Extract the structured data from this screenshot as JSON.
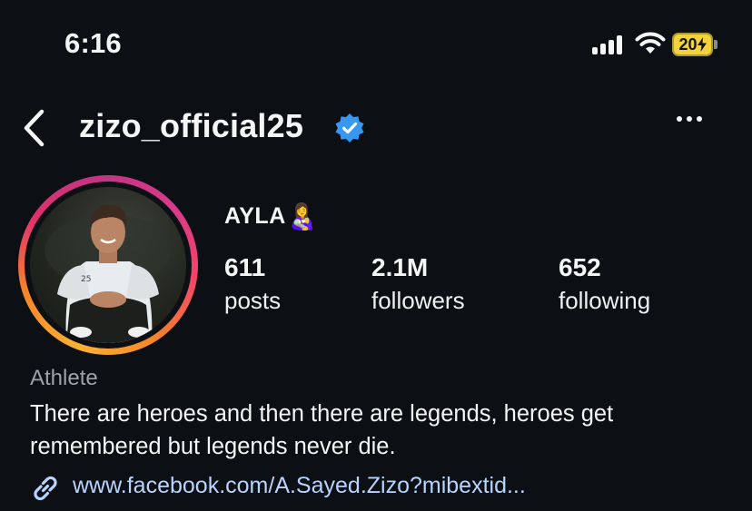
{
  "status_bar": {
    "time": "6:16",
    "battery": "20",
    "battery_color": "#f3d23a"
  },
  "header": {
    "username": "zizo_official25",
    "icons": [
      "chevron-left-icon",
      "verified-badge-icon",
      "more-horizontal-icon"
    ]
  },
  "profile": {
    "display_name": "AYLA",
    "display_emoji": "👩‍🍼",
    "stats": [
      {
        "value": "611",
        "label": "posts"
      },
      {
        "value": "2.1M",
        "label": "followers"
      },
      {
        "value": "652",
        "label": "following"
      }
    ],
    "category": "Athlete",
    "bio": "There are heroes and then there are legends, heroes get remembered but legends never die.",
    "link": "www.facebook.com/A.Sayed.Zizo?mibextid..."
  },
  "colors": {
    "background": "#0c0f14",
    "verified_blue": "#3897f0",
    "link_color": "#b9d3ff",
    "category_gray": "#9ea3ab",
    "story_ring": [
      "#f9b233",
      "#f58529",
      "#e1306c",
      "#c13584"
    ]
  }
}
